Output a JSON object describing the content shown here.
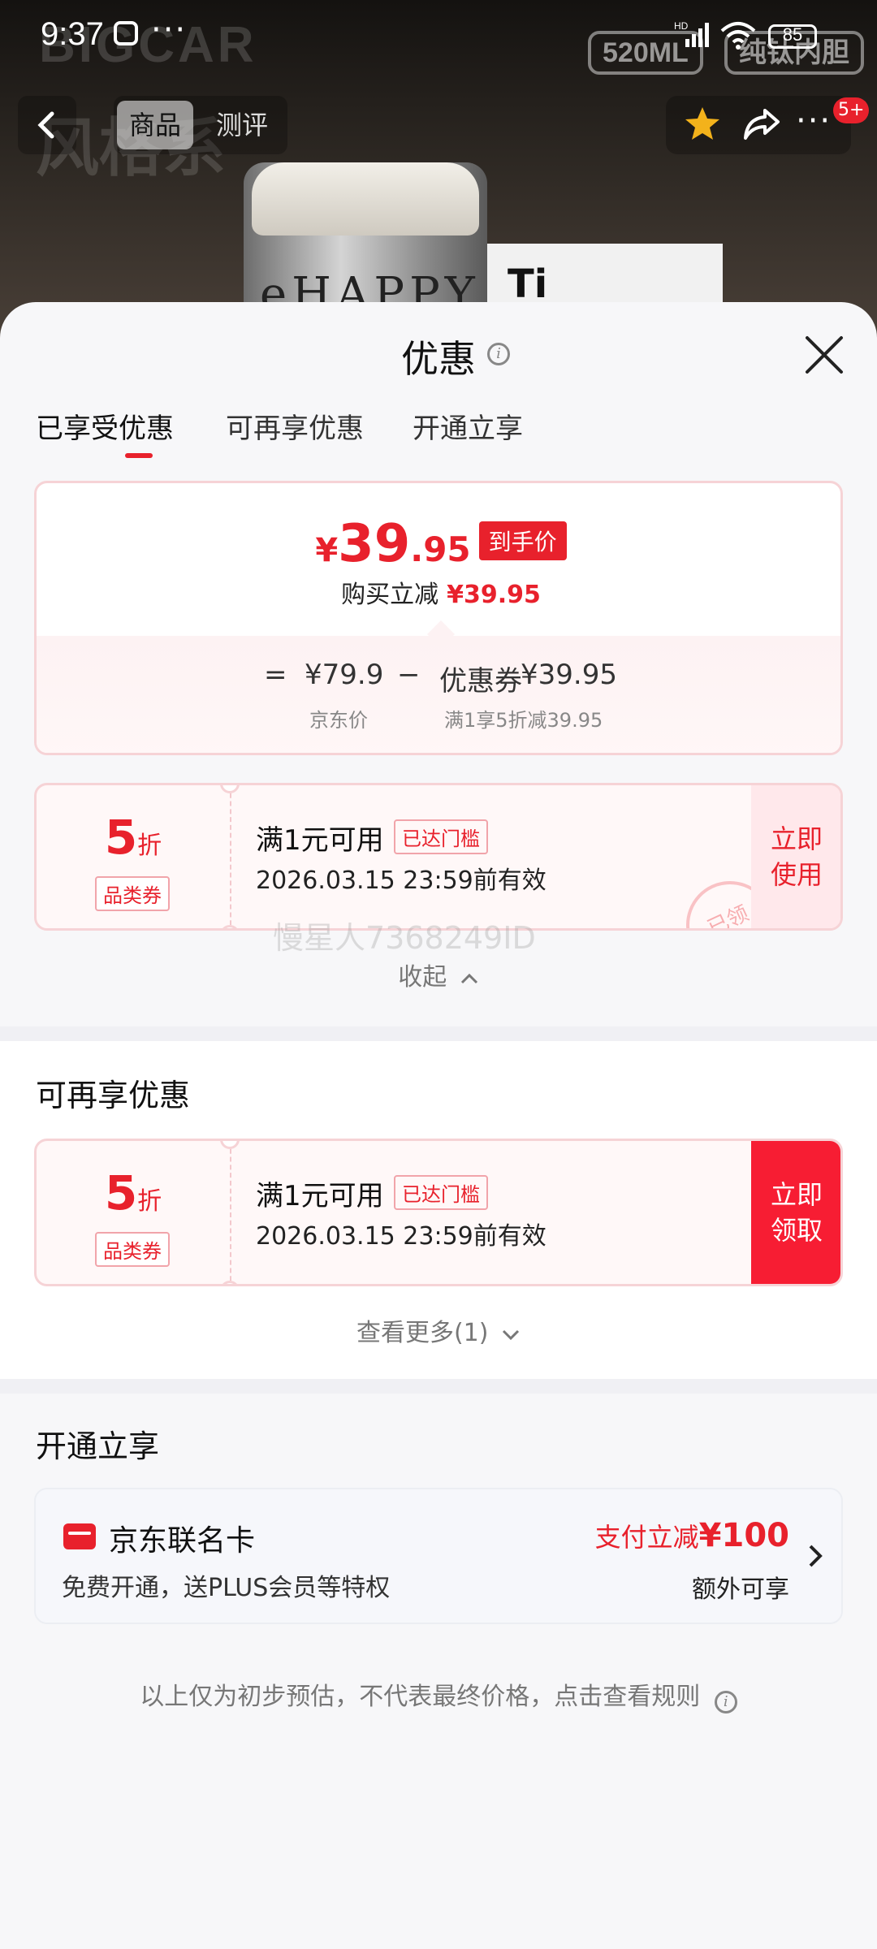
{
  "status_bar": {
    "time": "9:37",
    "battery": "85",
    "network": "HD"
  },
  "background": {
    "brand": "BIGCAR",
    "slogan": "风格系",
    "pill1": "520ML",
    "pill2": "纯钛内胆",
    "cup_text": "eHAPPY",
    "box_text": "Ti"
  },
  "nav": {
    "tabs": [
      "商品",
      "测评"
    ],
    "badge": "5+"
  },
  "sheet": {
    "title": "优惠",
    "tabs": [
      "已享受优惠",
      "可再享优惠",
      "开通立享"
    ]
  },
  "price": {
    "yen": "¥",
    "int": "39",
    "dec": ".95",
    "tag": "到手价",
    "sub_label": "购买立减",
    "sub_value": "¥39.95",
    "eq": "=",
    "jd_price": "¥79.9",
    "minus": "−",
    "coupon_label": "优惠券",
    "coupon_value": "¥39.95",
    "jd_price_label": "京东价",
    "coupon_rule": "满1享5折减39.95"
  },
  "coupons_used": [
    {
      "discount": "5",
      "unit": "折",
      "category": "品类券",
      "condition": "满1元可用",
      "met": "已达门槛",
      "valid": "2026.03.15 23:59前有效",
      "action_line1": "立即",
      "action_line2": "使用",
      "stamp": "已领"
    }
  ],
  "watermark": "慢星人7368249ID",
  "collapse_label": "收起",
  "section_more": {
    "title": "可再享优惠",
    "coupon": {
      "discount": "5",
      "unit": "折",
      "category": "品类券",
      "condition": "满1元可用",
      "met": "已达门槛",
      "valid": "2026.03.15 23:59前有效",
      "action_line1": "立即",
      "action_line2": "领取"
    },
    "more_label": "查看更多(1)"
  },
  "section_open": {
    "title": "开通立享",
    "card": {
      "name": "京东联名卡",
      "desc": "免费开通，送PLUS会员等特权",
      "promo_prefix": "支付立减",
      "promo_amount": "¥100",
      "extra": "额外可享"
    }
  },
  "footer_note": "以上仅为初步预估，不代表最终价格，点击查看规则",
  "colors": {
    "accent": "#e8212c",
    "accent_soft": "#ffe8eb"
  }
}
